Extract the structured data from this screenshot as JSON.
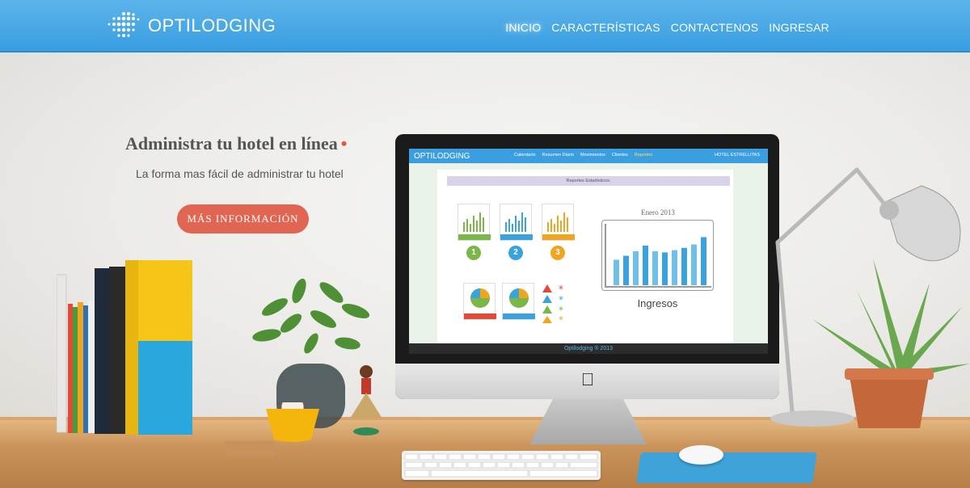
{
  "brand": {
    "name": "OPTILODGING"
  },
  "nav": {
    "items": [
      "INICIO",
      "CARACTERÍSTICAS",
      "CONTACTENOS",
      "INGRESAR"
    ]
  },
  "hero": {
    "title": "Administra tu hotel en línea",
    "subtitle": "La forma mas fácil de administrar tu hotel",
    "cta": "MÁS INFORMACIÓN"
  },
  "screen": {
    "brand": "OPTILODGING",
    "links": [
      "Calendario",
      "Resumen Diario",
      "Movimientos",
      "Clientes",
      "Reportes"
    ],
    "active_link": "Reportes",
    "hotel": "HOTEL ESTRELLITAS",
    "panel_heading": "Reportes Estadísticos.",
    "badges": [
      "1",
      "2",
      "3"
    ],
    "report_month": "Enero 2013",
    "report_label": "Ingresos",
    "report_values": [
      0.45,
      0.52,
      0.6,
      0.7,
      0.6,
      0.58,
      0.62,
      0.66,
      0.72,
      0.85
    ],
    "footer": "Optilodging ® 2013"
  },
  "colors": {
    "nav": "#3a9ee0",
    "cta": "#e06552",
    "accent_dot": "#e2573f",
    "green": "#7ab648",
    "blue": "#3aa2dd",
    "orange": "#f0a520"
  }
}
